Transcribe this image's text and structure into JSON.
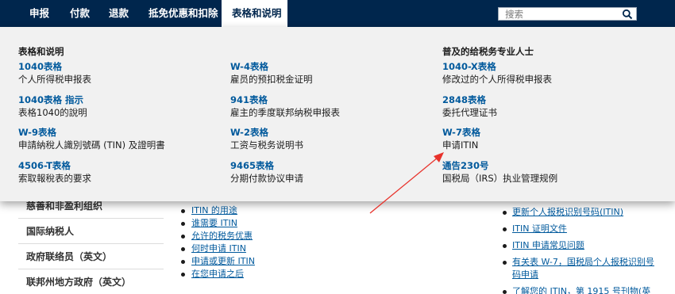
{
  "nav": {
    "items": [
      "申报",
      "付款",
      "退款",
      "抵免优惠和扣除",
      "表格和说明"
    ],
    "active_index": 4,
    "search_placeholder": "搜索"
  },
  "menu": {
    "col1": {
      "heading": "表格和说明",
      "entries": [
        {
          "link": "1040表格",
          "desc": "个人所得税申报表"
        },
        {
          "link": "1040表格 指示",
          "desc": "表格1040的說明"
        },
        {
          "link": "W-9表格",
          "desc": "申請納稅人識別號碼 (TIN) 及證明書"
        },
        {
          "link": "4506-T表格",
          "desc": "索取報稅表的要求"
        }
      ]
    },
    "col2": {
      "entries": [
        {
          "link": "W-4表格",
          "desc": "雇员的预扣税金证明"
        },
        {
          "link": "941表格",
          "desc": "雇主的季度联邦纳税申报表"
        },
        {
          "link": "W-2表格",
          "desc": "工资与税务说明书"
        },
        {
          "link": "9465表格",
          "desc": "分期付款协议申请"
        }
      ]
    },
    "col3": {
      "heading": "普及的给税务专业人士",
      "entries": [
        {
          "link": "1040-X表格",
          "desc": "修改过的个人所得税申报表"
        },
        {
          "link": "2848表格",
          "desc": "委托代理证书"
        },
        {
          "link": "W-7表格",
          "desc": "申请ITIN"
        },
        {
          "link": "通告230号",
          "desc": "国税局（IRS）执业管理规例"
        }
      ]
    }
  },
  "background": {
    "sidebar": [
      "慈善和非盈利组织",
      "国际纳税人",
      "政府联络员（英文）",
      "联邦州地方政府（英文）"
    ],
    "links": [
      "ITIN 的用途",
      "谁需要 ITIN",
      "允许的税务优惠",
      "何时申请 ITIN",
      "申请或更新 ITIN",
      "在您申请之后"
    ],
    "right_links": [
      "更新个人报税识别号码(ITIN)",
      "ITIN 证明文件",
      "ITIN 申请常见问题",
      "有关表 W-7，国税局个人报税识别号码申请",
      "了解您的 ITIN，第 1915 号刊物(英"
    ]
  },
  "colors": {
    "nav_bg": "#00264d",
    "link": "#00599c",
    "arrow": "#e8322b"
  }
}
